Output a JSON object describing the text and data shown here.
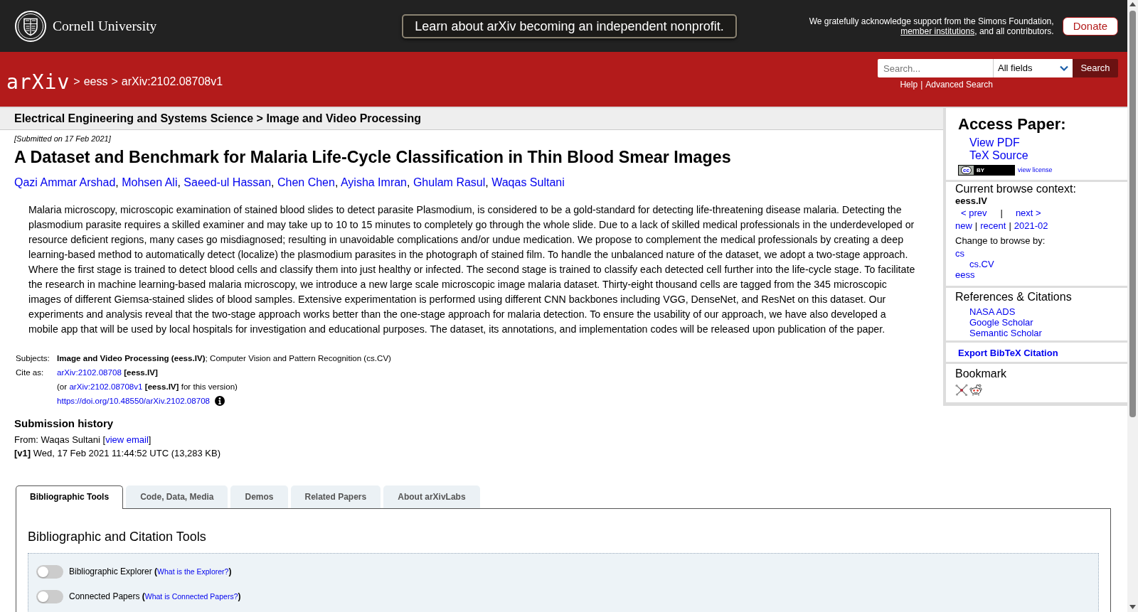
{
  "top_bar": {
    "institution": "Cornell University",
    "banner": "Learn about arXiv becoming an independent nonprofit.",
    "acknowledgment": [
      {
        "kind": "text",
        "text": "We gratefully acknowledge support from the Simons Foundation, "
      },
      {
        "kind": "link",
        "text": "member institutions"
      },
      {
        "kind": "text",
        "text": ", and all contributors."
      }
    ],
    "donate": "Donate"
  },
  "header": {
    "logo": "arXiv",
    "separator": ">",
    "breadcrumb": [
      "eess",
      "arXiv:2102.08708v1"
    ],
    "search": {
      "placeholder": "Search...",
      "field": "All fields",
      "button": "Search",
      "links": [
        "Help",
        "Advanced Search"
      ],
      "separator": "|"
    }
  },
  "category_bar": "Electrical Engineering and Systems Science > Image and Video Processing",
  "paper": {
    "submitted": "[Submitted on 17 Feb 2021]",
    "title": "A Dataset and Benchmark for Malaria Life-Cycle Classification in Thin Blood Smear Images",
    "authors": [
      "Qazi Ammar Arshad",
      "Mohsen Ali",
      "Saeed-ul Hassan",
      "Chen Chen",
      "Ayisha Imran",
      "Ghulam Rasul",
      "Waqas Sultani"
    ],
    "author_separator": ", ",
    "abstract": "Malaria microscopy, microscopic examination of stained blood slides to detect parasite Plasmodium, is considered to be a gold-standard for detecting life-threatening disease malaria. Detecting the plasmodium parasite requires a skilled examiner and may take up to 10 to 15 minutes to completely go through the whole slide. Due to a lack of skilled medical professionals in the underdeveloped or resource deficient regions, many cases go misdiagnosed; resulting in unavoidable complications and/or undue medication. We propose to complement the medical professionals by creating a deep learning-based method to automatically detect (localize) the plasmodium parasites in the photograph of stained film. To handle the unbalanced nature of the dataset, we adopt a two-stage approach. Where the first stage is trained to detect blood cells and classify them into just healthy or infected. The second stage is trained to classify each detected cell further into the life-cycle stage. To facilitate the research in machine learning-based malaria microscopy, we introduce a new large scale microscopic image malaria dataset. Thirty-eight thousand cells are tagged from the 345 microscopic images of different Giemsa-stained slides of blood samples. Extensive experimentation is performed using different CNN backbones including VGG, DenseNet, and ResNet on this dataset. Our experiments and analysis reveal that the two-stage approach works better than the one-stage approach for malaria detection. To ensure the usability of our approach, we have also developed a mobile app that will be used by local hospitals for investigation and educational purposes. The dataset, its annotations, and implementation codes will be released upon publication of the paper."
  },
  "metadata": {
    "subjects": {
      "label": "Subjects:",
      "value": "**Image and Video Processing (eess.IV)**; Computer Vision and Pattern Recognition (cs.CV)"
    },
    "cite_as": {
      "label": "Cite as:",
      "id_link": "arXiv:2102.08708",
      "id_suffix": " **[eess.IV]**",
      "version_prefix": "(or ",
      "version_link": "arXiv:2102.08708v1",
      "version_suffix": " **[eess.IV]** for this version)",
      "doi": "https://doi.org/10.48550/arXiv.2102.08708"
    }
  },
  "submission_history": {
    "heading": "Submission history",
    "from_prefix": "From: Waqas Sultani [",
    "email_link": "view email",
    "from_suffix": "]",
    "versions": [
      "**[v1]** Wed, 17 Feb 2021 11:44:52 UTC (13,283 KB)"
    ]
  },
  "sidebar": {
    "access": {
      "heading": "Access Paper:",
      "links": [
        "View PDF",
        "TeX Source"
      ],
      "license_badge": [
        "cc",
        "BY"
      ],
      "license_link": "view license"
    },
    "browse": {
      "heading": "Current browse context:",
      "context": "eess.IV",
      "prev": "< prev",
      "divider": "|",
      "next": "next >",
      "lists": [
        "new",
        "recent",
        "2021-02"
      ],
      "change_label": "Change to browse by:",
      "categories": [
        {
          "label": "cs",
          "children": [
            {
              "label": "cs.CV"
            }
          ]
        },
        {
          "label": "eess"
        }
      ]
    },
    "references": {
      "heading": "References & Citations",
      "links": [
        "NASA ADS",
        "Google Scholar",
        "Semantic Scholar"
      ]
    },
    "export": "Export BibTeX Citation",
    "bookmark": {
      "heading": "Bookmark"
    }
  },
  "labs": {
    "tabs": [
      {
        "label": "Bibliographic Tools",
        "selected": true
      },
      {
        "label": "Code, Data, Media",
        "selected": false
      },
      {
        "label": "Demos",
        "selected": false
      },
      {
        "label": "Related Papers",
        "selected": false
      },
      {
        "label": "About arXivLabs",
        "selected": false
      }
    ],
    "heading": "Bibliographic and Citation Tools",
    "tools": [
      {
        "label": "Bibliographic Explorer",
        "open": "(",
        "link": "What is the Explorer?",
        "close": ")",
        "on": false
      },
      {
        "label": "Connected Papers",
        "open": "(",
        "link": "What is Connected Papers?",
        "close": ")",
        "on": false
      }
    ]
  }
}
